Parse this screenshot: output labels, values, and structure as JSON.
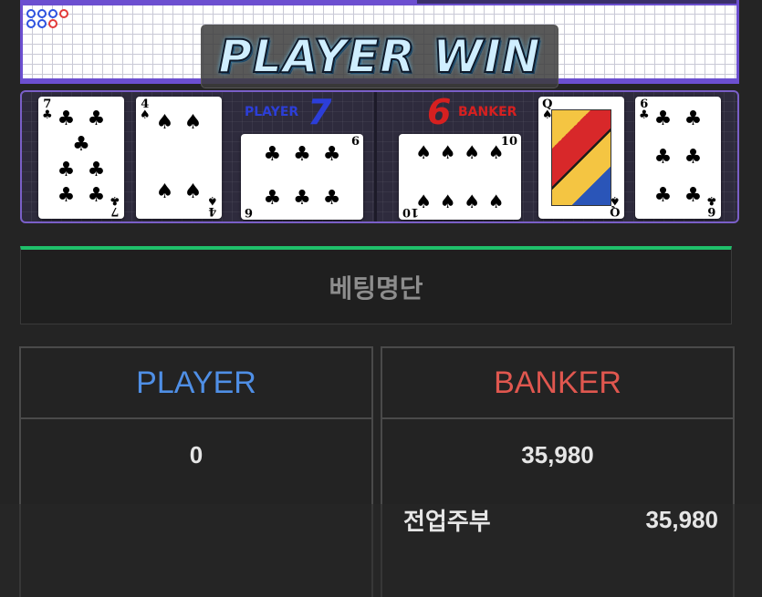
{
  "banner": {
    "result": "PLAYER WIN"
  },
  "player": {
    "label": "PLAYER",
    "score": "7",
    "cards": [
      {
        "rank": "7",
        "suit": "♣"
      },
      {
        "rank": "4",
        "suit": "♠"
      },
      {
        "rank": "6",
        "suit": "♣"
      }
    ]
  },
  "banker": {
    "label": "BANKER",
    "score": "6",
    "cards": [
      {
        "rank": "10",
        "suit": "♠"
      },
      {
        "rank": "Q",
        "suit": "♠"
      },
      {
        "rank": "6",
        "suit": "♣"
      }
    ]
  },
  "bet_list": {
    "title": "베팅명단",
    "player": {
      "header": "PLAYER",
      "total": "0"
    },
    "banker": {
      "header": "BANKER",
      "total": "35,980",
      "entries": [
        {
          "name": "전업주부",
          "amount": "35,980"
        }
      ]
    }
  },
  "colors": {
    "player": "#4f8fe6",
    "banker": "#e0574f",
    "accent_green": "#1fc06a",
    "purple": "#6c4fd0"
  }
}
